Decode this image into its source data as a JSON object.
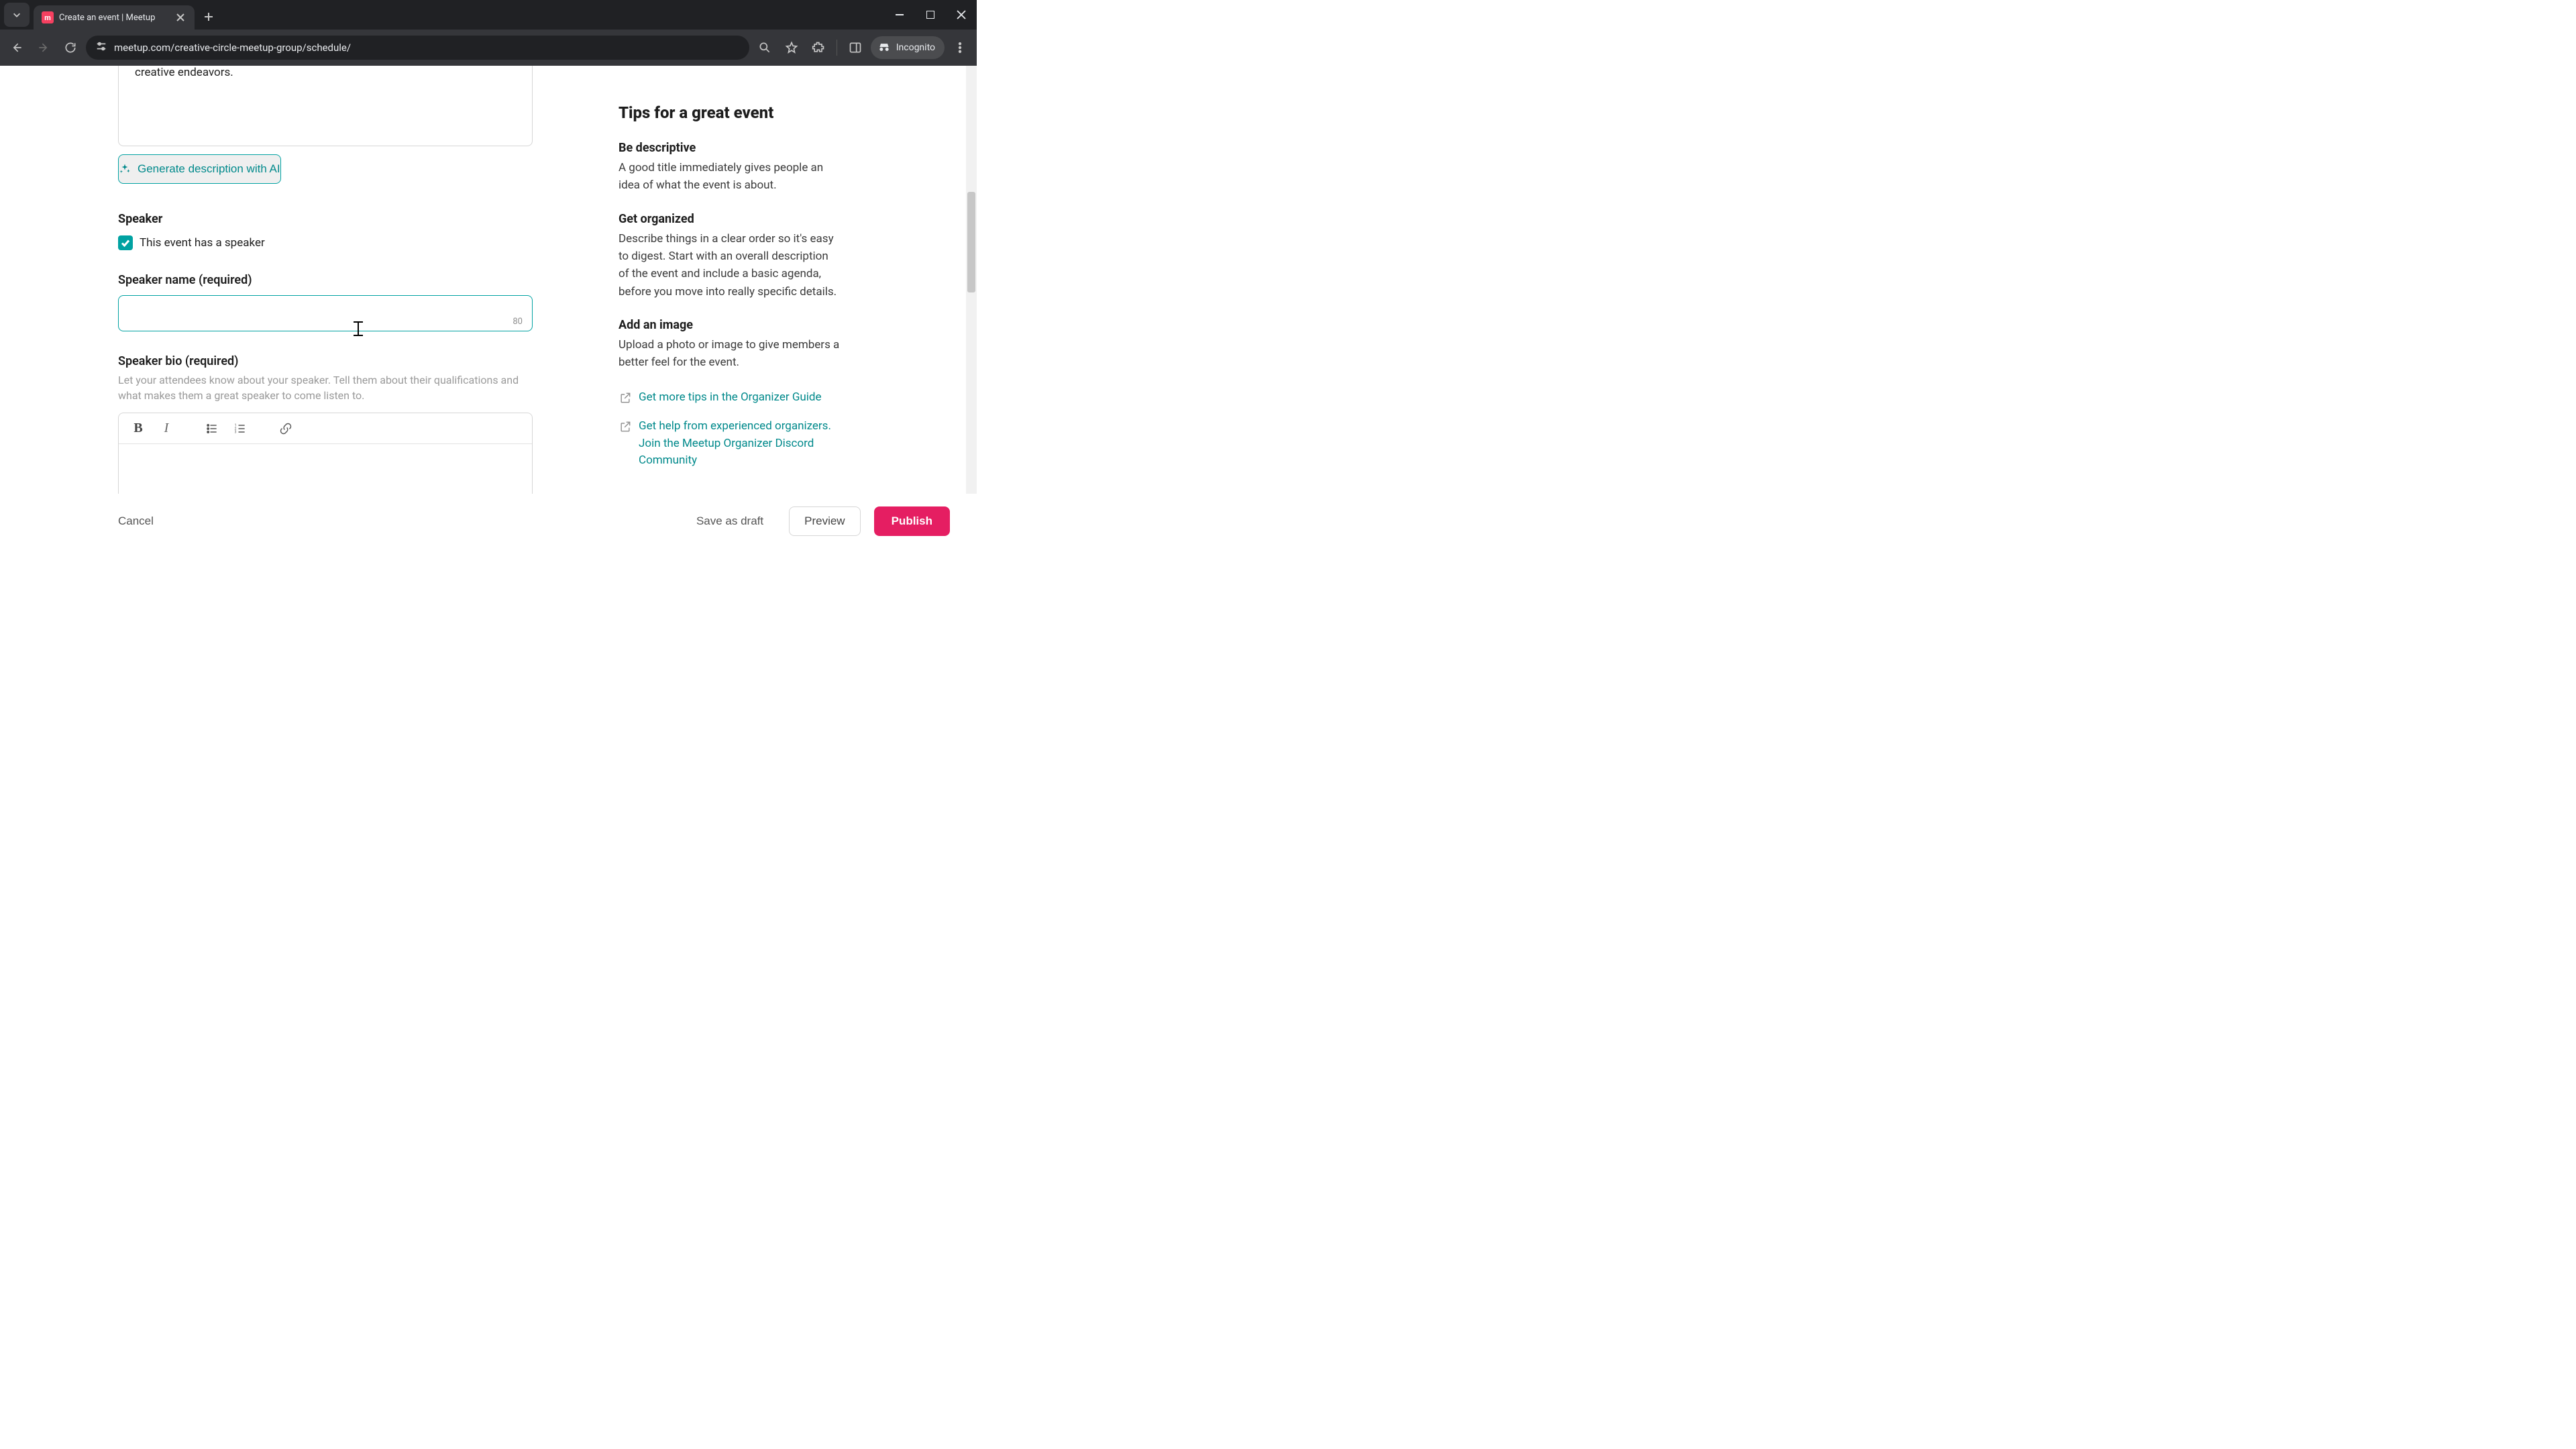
{
  "browser": {
    "tab_title": "Create an event | Meetup",
    "url": "meetup.com/creative-circle-meetup-group/schedule/",
    "incognito_label": "Incognito"
  },
  "description": {
    "visible_fragment": "creative endeavors.",
    "generate_ai_label": "Generate description with AI"
  },
  "speaker": {
    "section_title": "Speaker",
    "checkbox_label": "This event has a speaker",
    "checkbox_checked": true,
    "name_label": "Speaker name (required)",
    "name_value": "",
    "name_char_limit": "80",
    "bio_label": "Speaker bio (required)",
    "bio_hint": "Let your attendees know about your speaker. Tell them about their qualifications and what makes them a great speaker to come listen to."
  },
  "tips": {
    "heading": "Tips for a great event",
    "items": [
      {
        "title": "Be descriptive",
        "body": "A good title immediately gives people an idea of what the event is about."
      },
      {
        "title": "Get organized",
        "body": "Describe things in a clear order so it's easy to digest. Start with an overall description of the event and include a basic agenda, before you move into really specific details."
      },
      {
        "title": "Add an image",
        "body": "Upload a photo or image to give members a better feel for the event."
      }
    ],
    "link1": "Get more tips in the Organizer Guide",
    "link2": "Get help from experienced organizers. Join the Meetup Organizer Discord Community"
  },
  "footer": {
    "cancel": "Cancel",
    "save_draft": "Save as draft",
    "preview": "Preview",
    "publish": "Publish"
  }
}
